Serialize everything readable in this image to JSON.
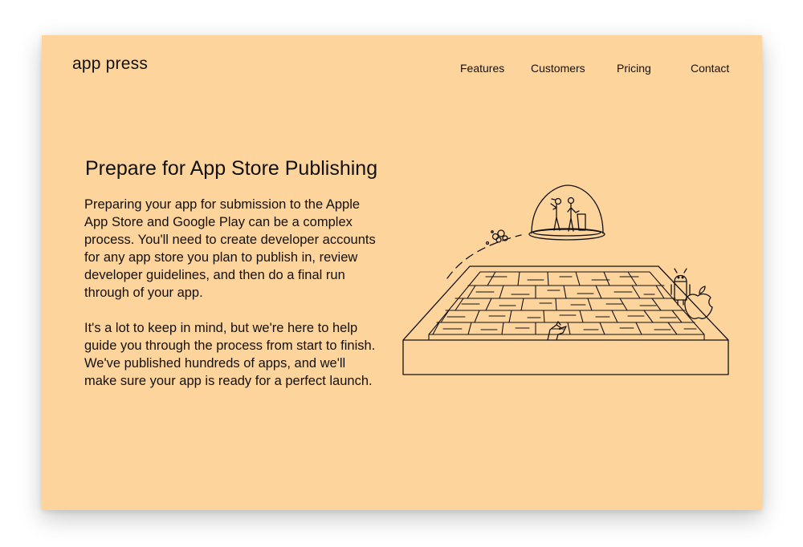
{
  "brand": {
    "logo_text": "app press"
  },
  "nav": {
    "items": [
      {
        "label": "Features"
      },
      {
        "label": "Customers"
      },
      {
        "label": "Pricing"
      },
      {
        "label": "Contact"
      }
    ]
  },
  "hero": {
    "title": "Prepare for App Store Publishing",
    "paragraphs": [
      "Preparing your app for submission to the Apple App Store and Google Play can be a complex process. You'll need to create developer accounts for any app store you plan to publish in, review developer guidelines, and then do a final run through of your app.",
      "It's a lot to keep in mind, but we're here to help guide you through the process from start to finish. We've published hundreds of apps, and we'll make sure your app is ready for a perfect launch."
    ]
  },
  "illustration": {
    "description_icons": [
      "maze-illustration",
      "glass-dome-icon",
      "android-icon",
      "apple-icon",
      "dog-icon"
    ]
  },
  "colors": {
    "card_background": "#fed49d",
    "text": "#111111",
    "page_background": "#ffffff"
  }
}
